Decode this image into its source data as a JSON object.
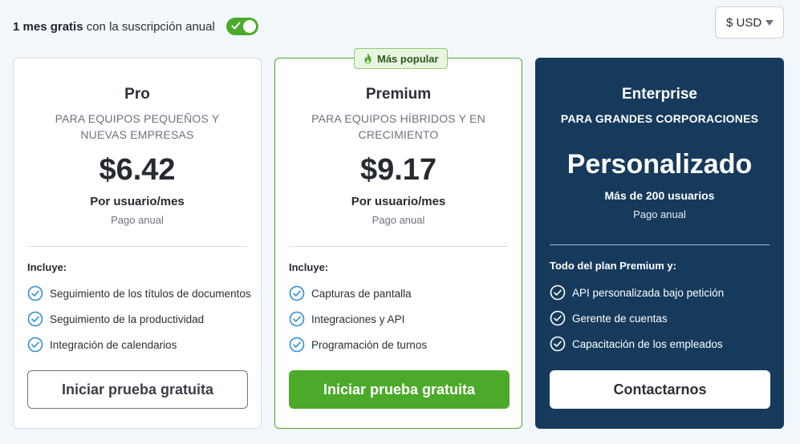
{
  "promo": {
    "bold": "1 mes gratis",
    "text": "con la suscripción anual",
    "toggle_on": true
  },
  "currency": {
    "label": "$ USD"
  },
  "colors": {
    "accent_green": "#4caa2a",
    "enterprise_bg": "#163a5c",
    "check_blue": "#2f8fd8"
  },
  "plans": [
    {
      "name": "Pro",
      "subtitle": "PARA EQUIPOS PEQUEÑOS Y NUEVAS EMPRESAS",
      "price": "$6.42",
      "per": "Por usuario/mes",
      "billing": "Pago anual",
      "includes": "Incluye:",
      "features": [
        "Seguimiento de los títulos de documentos",
        "Seguimiento de la productividad",
        "Integración de calendarios"
      ],
      "button": "Iniciar prueba gratuita"
    },
    {
      "name": "Premium",
      "badge": "Más popular",
      "subtitle": "PARA EQUIPOS HÍBRIDOS Y EN CRECIMIENTO",
      "price": "$9.17",
      "per": "Por usuario/mes",
      "billing": "Pago anual",
      "includes": "Incluye:",
      "features": [
        "Capturas de pantalla",
        "Integraciones y API",
        "Programación de turnos"
      ],
      "button": "Iniciar prueba gratuita"
    },
    {
      "name": "Enterprise",
      "subtitle": "PARA GRANDES CORPORACIONES",
      "price": "Personalizado",
      "per": "Más de 200 usuarios",
      "billing": "Pago anual",
      "includes": "Todo del plan Premium y:",
      "features": [
        "API personalizada bajo petición",
        "Gerente de cuentas",
        "Capacitación de los empleados"
      ],
      "button": "Contactarnos"
    }
  ]
}
